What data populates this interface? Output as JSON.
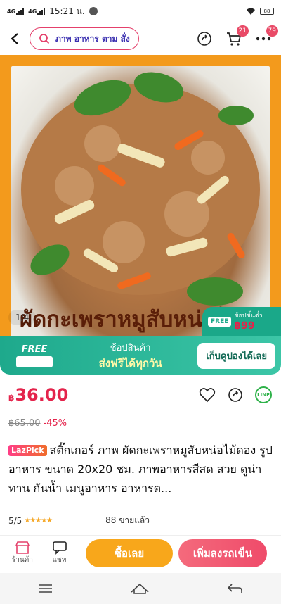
{
  "status_bar": {
    "time": "15:21 น.",
    "net1": "4G",
    "net2": "4G",
    "battery": "88"
  },
  "topbar": {
    "search_text": "ภาพ อาหาร ตาม สั่ง",
    "cart_badge": "21",
    "more_badge": "79"
  },
  "hero": {
    "caption": "ผัดกะเพราหมูสับหน่อไม้",
    "page_indicator": "1/4",
    "free_corner_small": "ช้อปขั้นต่ำ",
    "free_corner_price": "฿99",
    "free_corner_badge": "FREE"
  },
  "banner": {
    "free_label": "FREE",
    "line1": "ช้อปสินค้า",
    "line2": "ส่งฟรีได้ทุกวัน",
    "button": "เก็บคูปองได้เลย"
  },
  "product": {
    "currency": "฿",
    "price": "36.00",
    "original_price": "฿65.00",
    "discount": "-45%",
    "tag": "LazPick",
    "title": "สติ๊กเกอร์ ภาพ ผัดกะเพราหมูสับหน่อไม้ดอง รูปอาหาร ขนาด 20x20 ซม. ภาพอาหารสีสด สวย ดูน่าทาน กันน้ำ เมนูอาหาร อาหารต...",
    "rating": "5/5",
    "stars": "★★★★★",
    "sold": "88 ขายแล้ว",
    "line_label": "LINE"
  },
  "bottom": {
    "store_label": "ร้านค้า",
    "chat_label": "แชท",
    "buy_now": "ซื้อเลย",
    "add_cart": "เพิ่มลงรถเข็น"
  }
}
